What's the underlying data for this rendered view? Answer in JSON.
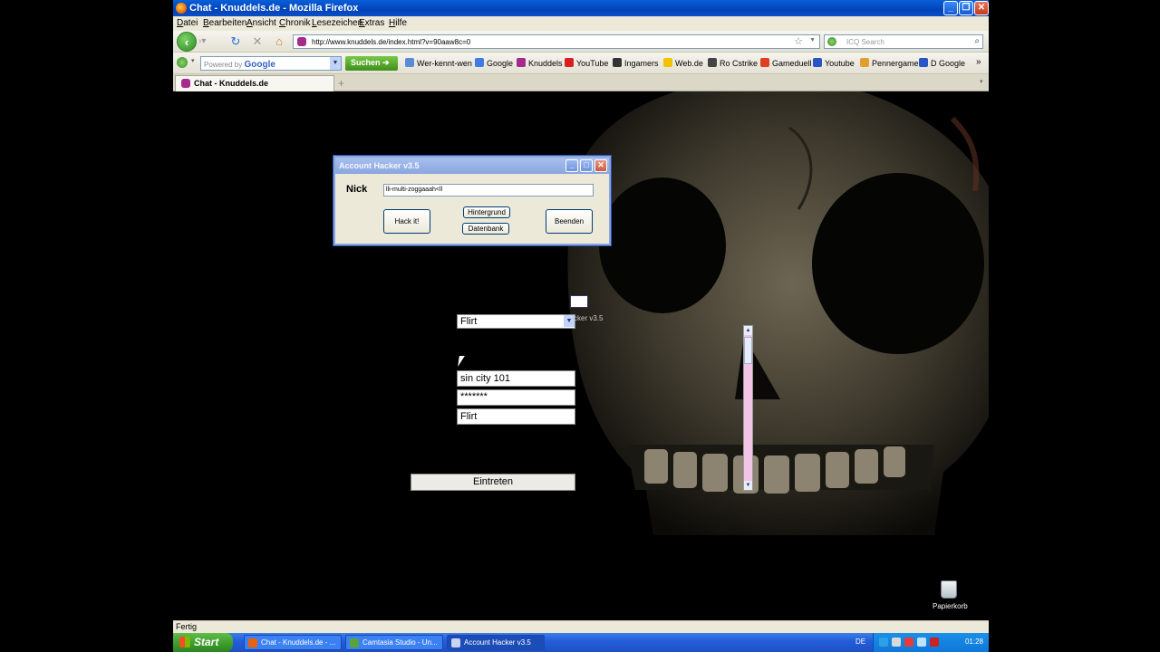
{
  "window": {
    "title": "Chat - Knuddels.de - Mozilla Firefox"
  },
  "menu": [
    "Datei",
    "Bearbeiten",
    "Ansicht",
    "Chronik",
    "Lesezeichen",
    "Extras",
    "Hilfe"
  ],
  "nav": {
    "url": "http://www.knuddels.de/index.html?v=90aaw8c=0",
    "search_placeholder": "ICQ Search"
  },
  "google_bar": {
    "powered": "Powered by",
    "google": "Google",
    "search_button": "Suchen"
  },
  "bookmarks": [
    {
      "label": "Wer-kennt-wen",
      "color": "#5b8bd6"
    },
    {
      "label": "Google",
      "color": "#3f7be0"
    },
    {
      "label": "Knuddels",
      "color": "#a52a8c"
    },
    {
      "label": "YouTube",
      "color": "#d92020"
    },
    {
      "label": "Ingamers",
      "color": "#333333"
    },
    {
      "label": "Web.de",
      "color": "#f2c100"
    },
    {
      "label": "Ro Cstrike",
      "color": "#444444"
    },
    {
      "label": "Gameduell",
      "color": "#e04020"
    },
    {
      "label": "Youtube",
      "color": "#2a55c8"
    },
    {
      "label": "Pennergame",
      "color": "#e0a030"
    },
    {
      "label": "D Google",
      "color": "#2a55c8"
    }
  ],
  "tab": {
    "label": "Chat - Knuddels.de"
  },
  "dialog": {
    "title": "Account Hacker v3.5",
    "nick_label": "Nick",
    "nick_value": "lli-multi-zoggaaah<ll",
    "hack_button": "Hack it!",
    "background_button": "Hintergrund",
    "database_button": "Datenbank",
    "exit_button": "Beenden"
  },
  "login": {
    "channel_select": "Flirt",
    "hint": "cker v3.5",
    "nick": "sin city 101",
    "password": "*******",
    "channel": "Flirt",
    "enter_button": "Eintreten"
  },
  "desktop": {
    "trash_label": "Papierkorb"
  },
  "status": {
    "text": "Fertig"
  },
  "taskbar": {
    "start": "Start",
    "items": [
      {
        "label": "Chat - Knuddels.de - ...",
        "color": "#e8640c"
      },
      {
        "label": "Camtasia Studio - Un...",
        "color": "#5ca23c"
      },
      {
        "label": "Account Hacker v3.5",
        "color": "#c8d4f0"
      }
    ],
    "lang": "DE",
    "clock": "01:28"
  }
}
